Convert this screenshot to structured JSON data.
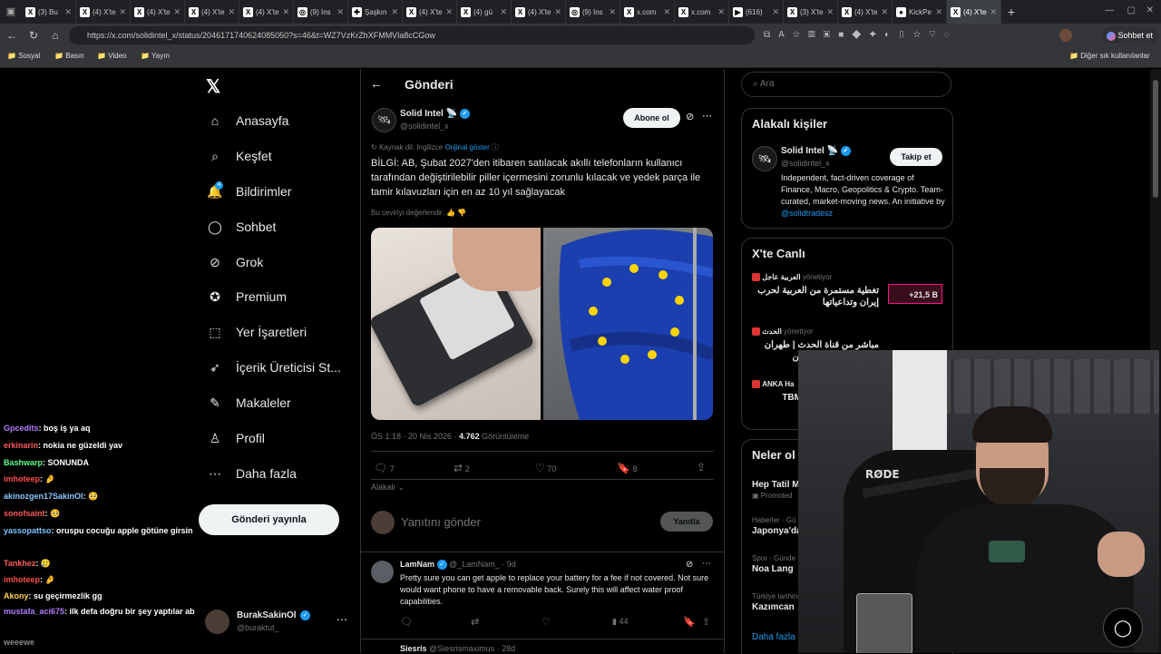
{
  "browser": {
    "tabs": [
      {
        "icon": "X",
        "label": "(3) Bu"
      },
      {
        "icon": "X",
        "label": "(4) X'te"
      },
      {
        "icon": "X",
        "label": "(4) X'te"
      },
      {
        "icon": "X",
        "label": "(4) X'te"
      },
      {
        "icon": "X",
        "label": "(4) X'te"
      },
      {
        "icon": "◎",
        "label": "(9) Ins"
      },
      {
        "icon": "✚",
        "label": "Şaşkın"
      },
      {
        "icon": "X",
        "label": "(4) X'te"
      },
      {
        "icon": "X",
        "label": "(4) gü"
      },
      {
        "icon": "X",
        "label": "(4) X'te"
      },
      {
        "icon": "◎",
        "label": "(9) Ins"
      },
      {
        "icon": "X",
        "label": "x.com"
      },
      {
        "icon": "X",
        "label": "x.com"
      },
      {
        "icon": "▶",
        "label": "(616)"
      },
      {
        "icon": "X",
        "label": "(3) X'te"
      },
      {
        "icon": "X",
        "label": "(4) X'te"
      },
      {
        "icon": "●",
        "label": "KickPe"
      },
      {
        "icon": "X",
        "label": "(4) X'te"
      }
    ],
    "url": "https://x.com/solidintel_x/status/2046171740624085050?s=46&t=WZ7VzKrZhXFMMVla8cCGow",
    "chat_button": "Sohbet et",
    "bookmarks": [
      "Sosyal",
      "Basın",
      "Video",
      "Yayın"
    ],
    "other_bookmarks": "Diğer sık kullanılanlar"
  },
  "nav": {
    "items": [
      {
        "icon": "home-icon",
        "label": "Anasayfa"
      },
      {
        "icon": "search-icon",
        "label": "Keşfet"
      },
      {
        "icon": "bell-icon",
        "label": "Bildirimler"
      },
      {
        "icon": "chat-icon",
        "label": "Sohbet"
      },
      {
        "icon": "grok-icon",
        "label": "Grok"
      },
      {
        "icon": "premium-icon",
        "label": "Premium"
      },
      {
        "icon": "bookmark-icon",
        "label": "Yer İşaretleri"
      },
      {
        "icon": "rocket-icon",
        "label": "İçerik Üreticisi St..."
      },
      {
        "icon": "article-icon",
        "label": "Makaleler"
      },
      {
        "icon": "profile-icon",
        "label": "Profil"
      },
      {
        "icon": "more-icon",
        "label": "Daha fazla"
      }
    ],
    "notif_badge": "4",
    "post_button": "Gönderi yayınla",
    "account": {
      "name": "BurakSakinOl",
      "handle": "@buraktut_"
    }
  },
  "post": {
    "header": "Gönderi",
    "author": {
      "name": "Solid Intel 📡",
      "handle": "@solidintel_x"
    },
    "subscribe": "Abone ol",
    "source_lang": "Kaynak dil: İngilizce",
    "show_original": "Orijinal göster",
    "text": "BİLGİ: AB, Şubat 2027'den itibaren satılacak akıllı telefonların kullanıcı tarafından değiştirilebilir piller içermesini zorunlu kılacak ve yedek parça ile tamir kılavuzları için en az 10 yıl sağlayacak",
    "rate_translation": "Bu çeviriyi değerlendir:",
    "meta_time": "ÖS 1:18 · 20 Nis 2026 · ",
    "views": "4.762",
    "views_label": "Görüntüleme",
    "replies": "7",
    "reposts": "2",
    "likes": "70",
    "bookmarks": "8",
    "sort": "Alakalı",
    "reply_placeholder": "Yanıtını gönder",
    "reply_button": "Yanıtla"
  },
  "reply": {
    "name": "LamNam",
    "handle": "@_LamNam_ · 9d",
    "text": "Pretty sure you can get apple to replace your battery for a fee if not covered. Not sure would want phone to have a removable back. Surely this will affect water proof capabilities.",
    "views": "44",
    "next_name": "Siesris",
    "next_handle": "@Siesrismaximus · 28d"
  },
  "right": {
    "search_placeholder": "Ara",
    "related_title": "Alakalı kişiler",
    "related": {
      "name": "Solid Intel 📡",
      "handle": "@solidintel_x",
      "follow": "Takip et",
      "bio": "Independent, fact-driven coverage of Finance, Macro, Geopolitics & Crypto. Team-curated, market-moving news. An initiative by ",
      "bio_link": "@solidtradesz"
    },
    "live_title": "X'te Canlı",
    "live": [
      {
        "source": "العربية عاجل",
        "status": "yönetiyor",
        "text": "تغطية مستمرة من العربية لحرب إيران وتداعياتها",
        "count": "+21,5 B"
      },
      {
        "source": "الحدث",
        "status": "yönetiyor",
        "text": "مباشر من قناة الحدث | طهران ترفض الجولة الثانية من",
        "count": ""
      },
      {
        "source": "ANKA Ha",
        "status": "",
        "text": "TBMM Gen Çocuk Öze",
        "count": ""
      }
    ],
    "trends_title": "Neler ol",
    "trends": [
      {
        "context": "",
        "title": "Hep Tatil M",
        "promoted": "Promoted"
      },
      {
        "context": "Haberler · Gü",
        "title": "Japonya'da",
        "promoted": ""
      },
      {
        "context": "Spor · Günde",
        "title": "Noa Lang",
        "promoted": ""
      },
      {
        "context": "Türkiye tarihinde gündemde",
        "title": "Kazımcan",
        "promoted": ""
      }
    ],
    "show_more": "Daha fazla göster"
  },
  "chat": [
    {
      "user": "Gpcedits",
      "color": "#b57cff",
      "msg": "boş iş ya aq"
    },
    {
      "user": "erkinarin",
      "color": "#ff5a5a",
      "msg": "nokia ne güzeldi yav"
    },
    {
      "user": "Bashwarp",
      "color": "#5aff8c",
      "msg": "SONUNDA"
    },
    {
      "user": "imhoteep",
      "color": "#ff4d4d",
      "msg": "🤌"
    },
    {
      "user": "akinozgen17SakinOl",
      "color": "#8cc8ff",
      "msg": "🥺"
    },
    {
      "user": "sonofsaint",
      "color": "#ff5a5a",
      "msg": "🥺"
    },
    {
      "user": "yassopattso",
      "color": "#7cc4ff",
      "msg": "oruspu cocuğu apple götüne girsin"
    },
    {
      "user": "Tankhez",
      "color": "#ff5a5a",
      "msg": "🥲"
    },
    {
      "user": "imhoteep",
      "color": "#ff4d4d",
      "msg": "🤌"
    },
    {
      "user": "Akony",
      "color": "#ffd24d",
      "msg": "su geçirmezlik gg"
    },
    {
      "user": "mustafa_aci675",
      "color": "#b57cff",
      "msg": "ilk defa doğru bir şey yaptılar ab"
    },
    {
      "user": "weeewe",
      "color": "#888888",
      "msg": ""
    }
  ],
  "colors": {
    "accent": "#1d9bf0",
    "bg": "#000000",
    "border": "#2f3336",
    "muted": "#71767b"
  }
}
